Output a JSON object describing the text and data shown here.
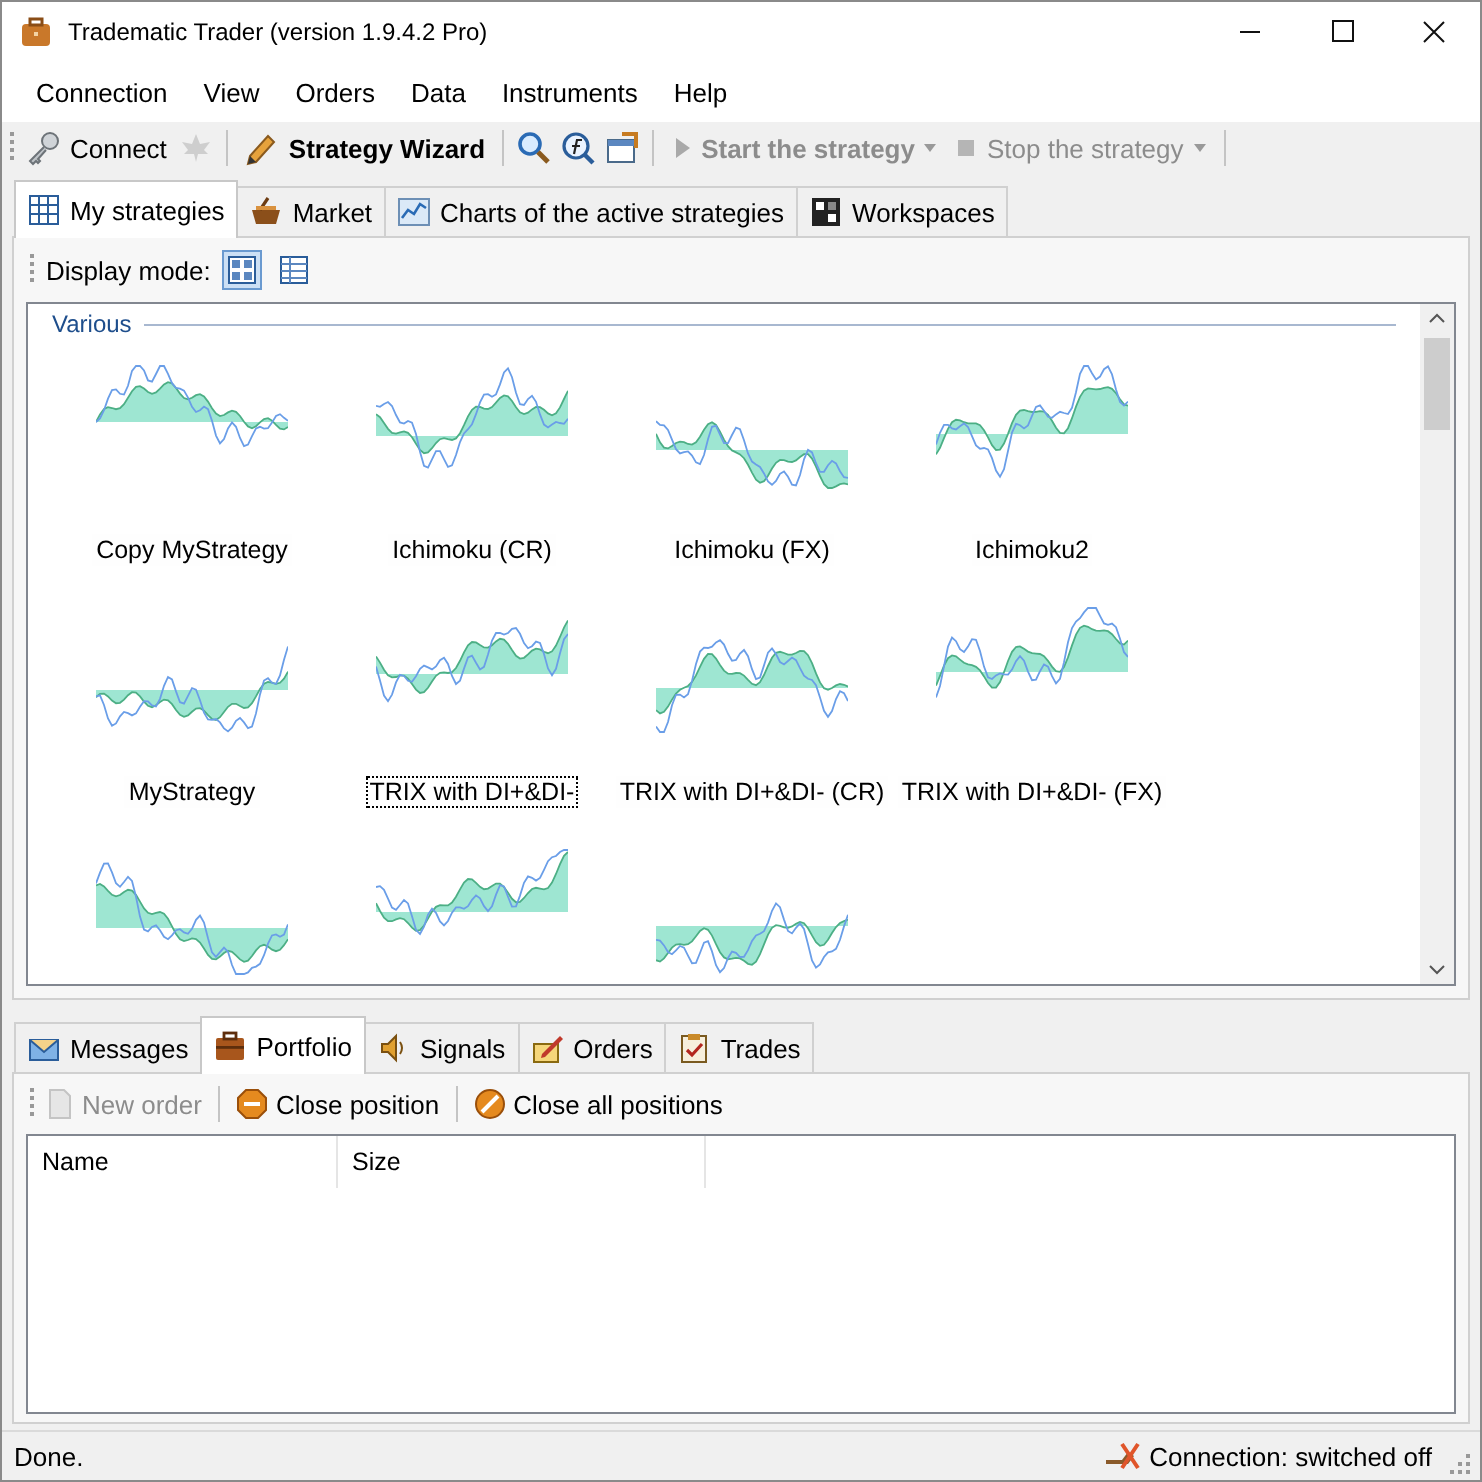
{
  "window": {
    "title": "Tradematic Trader (version 1.9.4.2 Pro)"
  },
  "menu": [
    "Connection",
    "View",
    "Orders",
    "Data",
    "Instruments",
    "Help"
  ],
  "toolbar": [
    {
      "kind": "button",
      "label": "Connect",
      "disabled": false,
      "bold": false
    },
    {
      "kind": "icon",
      "disabled": true
    },
    {
      "kind": "separator"
    },
    {
      "kind": "button",
      "label": "Strategy Wizard",
      "disabled": false,
      "bold": true
    },
    {
      "kind": "separator"
    },
    {
      "kind": "icon",
      "disabled": false
    },
    {
      "kind": "icon",
      "disabled": false
    },
    {
      "kind": "icon",
      "disabled": false
    },
    {
      "kind": "separator"
    },
    {
      "kind": "dropdown",
      "label": "Start the strategy",
      "disabled": true,
      "bold": true
    },
    {
      "kind": "dropdown",
      "label": "Stop the strategy",
      "disabled": true,
      "bold": false
    },
    {
      "kind": "separator"
    }
  ],
  "tabs": [
    {
      "label": "My strategies",
      "selected": true
    },
    {
      "label": "Market",
      "selected": false
    },
    {
      "label": "Charts of the active strategies",
      "selected": false
    },
    {
      "label": "Workspaces",
      "selected": false
    }
  ],
  "display_mode": {
    "label": "Display mode:",
    "options": [
      {
        "selected": true
      },
      {
        "selected": false
      }
    ]
  },
  "group": {
    "title": "Various"
  },
  "strategies": [
    {
      "name": "Copy MyStrategy",
      "selected": false
    },
    {
      "name": "Ichimoku (CR)",
      "selected": false
    },
    {
      "name": "Ichimoku (FX)",
      "selected": false
    },
    {
      "name": "Ichimoku2",
      "selected": false
    },
    {
      "name": "MyStrategy",
      "selected": false
    },
    {
      "name": "TRIX with DI+&DI-",
      "selected": true
    },
    {
      "name": "TRIX with DI+&DI- (CR)",
      "selected": false
    },
    {
      "name": "TRIX with DI+&DI- (FX)",
      "selected": false
    },
    {
      "selected": false
    },
    {
      "selected": false
    },
    {
      "selected": false
    }
  ],
  "bottom_tabs": [
    {
      "label": "Messages",
      "selected": false
    },
    {
      "label": "Portfolio",
      "selected": true
    },
    {
      "label": "Signals",
      "selected": false
    },
    {
      "label": "Orders",
      "selected": false
    },
    {
      "label": "Trades",
      "selected": false
    }
  ],
  "portfolio_toolbar": [
    {
      "label": "New order",
      "disabled": true
    },
    {
      "label": "Close position",
      "disabled": false
    },
    {
      "label": "Close all positions",
      "disabled": false
    }
  ],
  "table": {
    "columns": [
      "Name",
      "Size"
    ]
  },
  "status_bar": {
    "message": "Done.",
    "connection": "Connection: switched off"
  }
}
